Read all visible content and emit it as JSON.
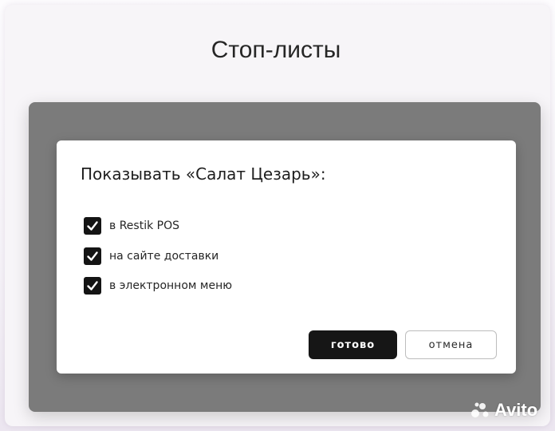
{
  "page": {
    "title": "Стоп-листы"
  },
  "dialog": {
    "title": "Показывать «Салат Цезарь»:",
    "options": [
      {
        "label": "в Restik POS",
        "checked": true
      },
      {
        "label": "на сайте доставки",
        "checked": true
      },
      {
        "label": "в электронном меню",
        "checked": true
      }
    ],
    "ok_label": "готово",
    "cancel_label": "отмена"
  },
  "watermark": {
    "text": "Avito"
  },
  "colors": {
    "overlay": "#7b7b7b",
    "dialog_bg": "#ffffff",
    "primary_button": "#161616",
    "checkbox": "#141414"
  }
}
